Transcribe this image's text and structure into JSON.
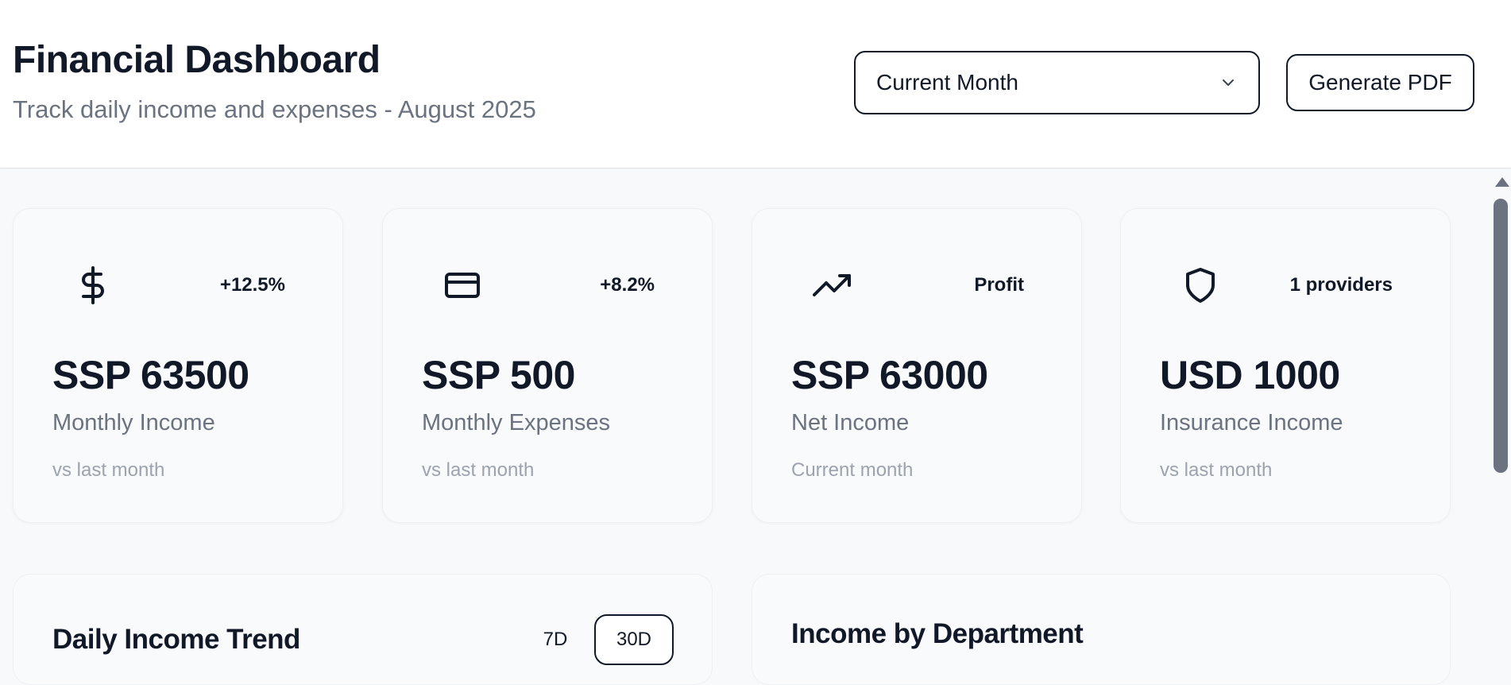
{
  "header": {
    "title": "Financial Dashboard",
    "subtitle": "Track daily income and expenses - August 2025",
    "period_select": {
      "value": "Current Month",
      "icon": "chevron-down-icon"
    },
    "generate_pdf_label": "Generate PDF"
  },
  "stats": [
    {
      "icon": "dollar-icon",
      "badge": "+12.5%",
      "value": "SSP 63500",
      "label": "Monthly Income",
      "note": "vs last month"
    },
    {
      "icon": "credit-card-icon",
      "badge": "+8.2%",
      "value": "SSP 500",
      "label": "Monthly Expenses",
      "note": "vs last month"
    },
    {
      "icon": "trending-up-icon",
      "badge": "Profit",
      "value": "SSP 63000",
      "label": "Net Income",
      "note": "Current month"
    },
    {
      "icon": "shield-icon",
      "badge": "1 providers",
      "value": "USD 1000",
      "label": "Insurance Income",
      "note": "vs last month"
    }
  ],
  "daily_trend": {
    "title": "Daily Income Trend",
    "ranges": [
      "7D",
      "30D"
    ],
    "active_range": "30D"
  },
  "department": {
    "title": "Income by Department"
  },
  "colors": {
    "text_primary": "#111827",
    "text_secondary": "#6b7280",
    "text_muted": "#9ca3af",
    "card_bg": "#f9fafb",
    "page_bg": "#f8f9fb"
  }
}
